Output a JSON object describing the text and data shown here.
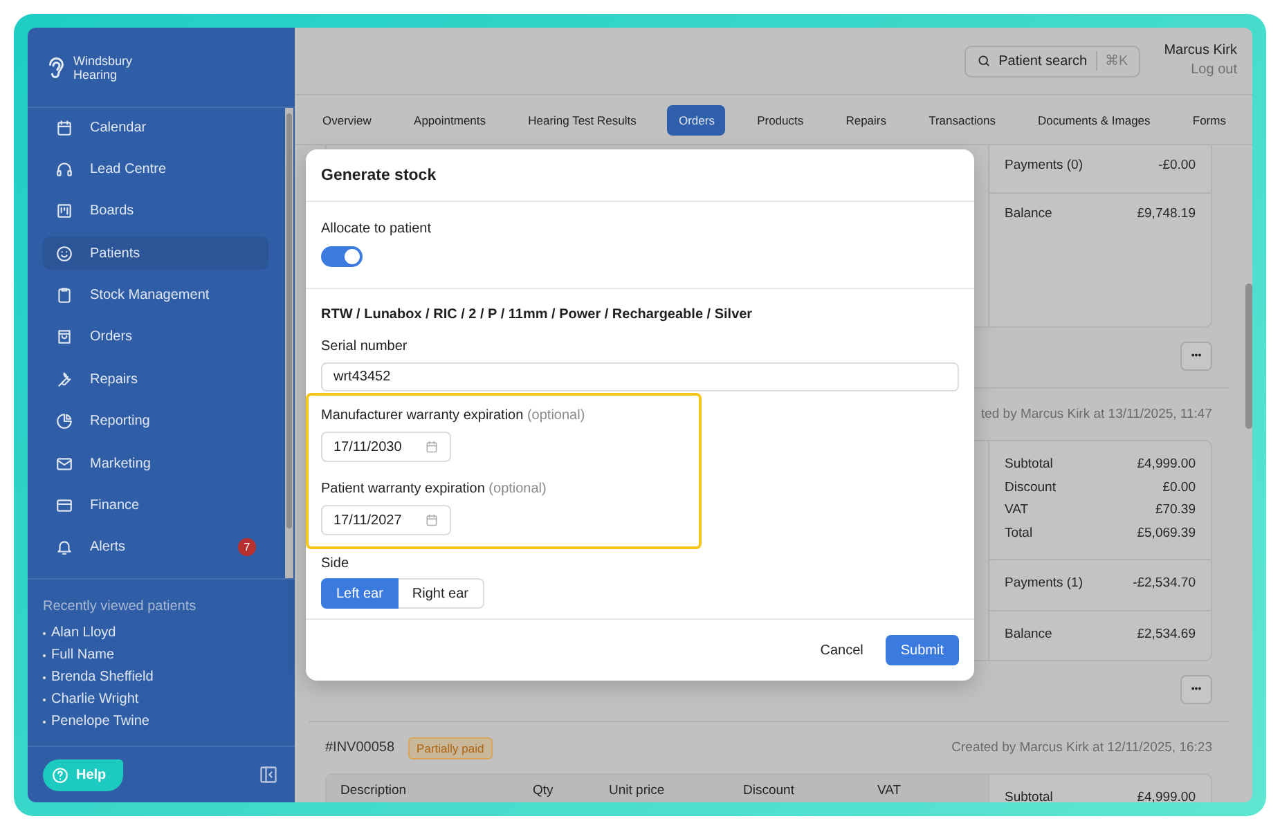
{
  "sidebar": {
    "brand": "Windsbury Hearing",
    "items": [
      {
        "label": "Calendar",
        "selected": false
      },
      {
        "label": "Lead Centre",
        "selected": false
      },
      {
        "label": "Boards",
        "selected": false
      },
      {
        "label": "Patients",
        "selected": true
      },
      {
        "label": "Stock Management",
        "selected": false
      },
      {
        "label": "Orders",
        "selected": false
      },
      {
        "label": "Repairs",
        "selected": false
      },
      {
        "label": "Reporting",
        "selected": false
      },
      {
        "label": "Marketing",
        "selected": false
      },
      {
        "label": "Finance",
        "selected": false
      },
      {
        "label": "Alerts",
        "selected": false,
        "badge": "7"
      }
    ],
    "recent": {
      "title": "Recently viewed patients",
      "patients": [
        "Alan Lloyd",
        "Full Name",
        "Brenda Sheffield",
        "Charlie Wright",
        "Penelope Twine"
      ]
    },
    "help": "Help"
  },
  "header": {
    "search": {
      "label": "Patient search",
      "shortcut": "⌘K"
    },
    "user": {
      "name": "Marcus Kirk",
      "logout": "Log out"
    }
  },
  "tabs": [
    {
      "label": "Overview",
      "selected": false
    },
    {
      "label": "Appointments",
      "selected": false
    },
    {
      "label": "Hearing Test Results",
      "selected": false
    },
    {
      "label": "Orders",
      "selected": true
    },
    {
      "label": "Products",
      "selected": false
    },
    {
      "label": "Repairs",
      "selected": false
    },
    {
      "label": "Transactions",
      "selected": false
    },
    {
      "label": "Documents & Images",
      "selected": false
    },
    {
      "label": "Forms",
      "selected": false
    }
  ],
  "invoices": [
    {
      "summary": [
        [
          {
            "label": "Payments (0)",
            "value": "-£0.00"
          }
        ],
        [
          {
            "label": "Balance",
            "value": "£9,748.19"
          }
        ]
      ],
      "more": "•••"
    },
    {
      "created": "ted by Marcus Kirk at 13/11/2025, 11:47",
      "summary": [
        [
          {
            "label": "Subtotal",
            "value": "£4,999.00"
          },
          {
            "label": "Discount",
            "value": "£0.00"
          },
          {
            "label": "VAT",
            "value": "£70.39"
          },
          {
            "label": "Total",
            "value": "£5,069.39"
          }
        ],
        [
          {
            "label": "Payments (1)",
            "value": "-£2,534.70"
          }
        ],
        [
          {
            "label": "Balance",
            "value": "£2,534.69"
          }
        ]
      ],
      "more": "•••"
    },
    {
      "number": "#INV00058",
      "status": "Partially paid",
      "created": "Created by Marcus Kirk at 12/11/2025, 16:23",
      "columns": [
        "Description",
        "Qty",
        "Unit price",
        "Discount",
        "VAT"
      ],
      "summary": [
        [
          {
            "label": "Subtotal",
            "value": "£4,999.00"
          }
        ]
      ]
    }
  ],
  "modal": {
    "title": "Generate stock",
    "allocate": {
      "label": "Allocate to patient",
      "on": true
    },
    "product": "RTW / Lunabox / RIC / 2 / P / 11mm / Power / Rechargeable / Silver",
    "serial": {
      "label": "Serial number",
      "value": "wrt43452"
    },
    "warranty": {
      "highlighted": true,
      "fields": [
        {
          "label": "Manufacturer warranty expiration",
          "note": "(optional)",
          "value": "17/11/2030"
        },
        {
          "label": "Patient warranty expiration",
          "note": "(optional)",
          "value": "17/11/2027"
        }
      ]
    },
    "side": {
      "label": "Side",
      "options": [
        {
          "label": "Left ear",
          "selected": true
        },
        {
          "label": "Right ear",
          "selected": false
        }
      ]
    },
    "cancel": "Cancel",
    "submit": "Submit"
  }
}
